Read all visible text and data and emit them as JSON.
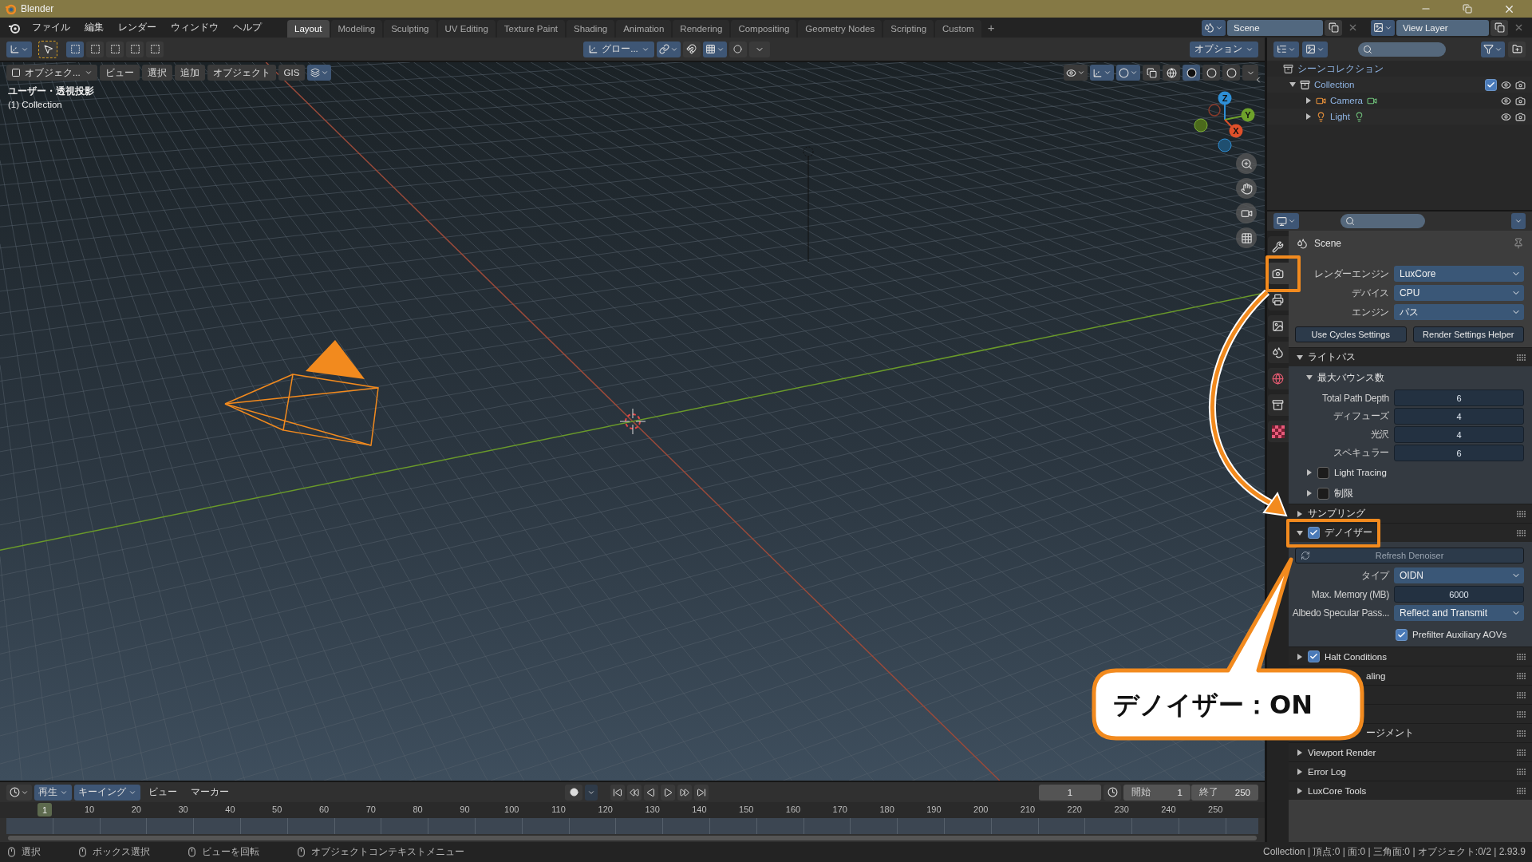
{
  "window": {
    "title": "Blender"
  },
  "menus": [
    "ファイル",
    "編集",
    "レンダー",
    "ウィンドウ",
    "ヘルプ"
  ],
  "workspaces": [
    {
      "label": "Layout",
      "selected": true
    },
    {
      "label": "Modeling",
      "selected": false
    },
    {
      "label": "Sculpting",
      "selected": false
    },
    {
      "label": "UV Editing",
      "selected": false
    },
    {
      "label": "Texture Paint",
      "selected": false
    },
    {
      "label": "Shading",
      "selected": false
    },
    {
      "label": "Animation",
      "selected": false
    },
    {
      "label": "Rendering",
      "selected": false
    },
    {
      "label": "Compositing",
      "selected": false
    },
    {
      "label": "Geometry Nodes",
      "selected": false
    },
    {
      "label": "Scripting",
      "selected": false
    },
    {
      "label": "Custom",
      "selected": false
    }
  ],
  "add_workspace": "+",
  "scene": "Scene",
  "view_layer": "View Layer",
  "tool_header": {
    "orientation": "グロー...",
    "options": "オプション"
  },
  "viewport": {
    "mode": "オブジェク...",
    "menus": [
      "ビュー",
      "選択",
      "追加",
      "オブジェクト",
      "GIS"
    ],
    "view_name": "ユーザー・透視投影",
    "collection": "(1) Collection",
    "axes": [
      "Z",
      "Y",
      "X"
    ]
  },
  "outliner": {
    "title": "シーンコレクション",
    "items": [
      {
        "label": "Collection",
        "checked": true,
        "expanded": true,
        "children": [
          {
            "label": "Camera",
            "kind": "camera"
          },
          {
            "label": "Light",
            "kind": "light"
          }
        ]
      }
    ]
  },
  "properties": {
    "context": "Scene",
    "tabs": [
      {
        "kind": "tool",
        "selected": false
      },
      {
        "kind": "render",
        "selected": true
      },
      {
        "kind": "output",
        "selected": false
      },
      {
        "kind": "view_layer",
        "selected": false
      },
      {
        "kind": "scene",
        "selected": false
      },
      {
        "kind": "world",
        "selected": false
      },
      {
        "kind": "collection",
        "selected": false
      },
      {
        "kind": "texture",
        "selected": false
      }
    ],
    "rows": [
      {
        "kind": "dropdown",
        "label": "レンダーエンジン",
        "value": "LuxCore"
      },
      {
        "kind": "dropdown",
        "label": "デバイス",
        "value": "CPU"
      },
      {
        "kind": "dropdown",
        "label": "エンジン",
        "value": "パス"
      },
      {
        "kind": "buttons",
        "items": [
          "Use Cycles Settings",
          "Render Settings Helper"
        ]
      },
      {
        "kind": "panel",
        "label": "ライトパス",
        "expanded": true
      },
      {
        "kind": "subpanel",
        "label": "最大バウンス数",
        "expanded": true
      },
      {
        "kind": "number",
        "label": "Total Path Depth",
        "value": "6"
      },
      {
        "kind": "number",
        "label": "ディフューズ",
        "value": "4"
      },
      {
        "kind": "number",
        "label": "光沢",
        "value": "4"
      },
      {
        "kind": "number",
        "label": "スペキュラー",
        "value": "6"
      },
      {
        "kind": "subpanel_check",
        "label": "Light Tracing",
        "checked": false,
        "expanded": false
      },
      {
        "kind": "subpanel_check",
        "label": "制限",
        "checked": false,
        "expanded": false
      },
      {
        "kind": "panel",
        "label": "サンプリング",
        "expanded": false
      },
      {
        "kind": "panel_check",
        "label": "デノイザー",
        "checked": true,
        "expanded": true
      },
      {
        "kind": "action",
        "label": "Refresh Denoiser",
        "disabled": true
      },
      {
        "kind": "dropdown",
        "label": "タイプ",
        "value": "OIDN"
      },
      {
        "kind": "number",
        "label": "Max. Memory (MB)",
        "value": "6000"
      },
      {
        "kind": "dropdown",
        "label": "Albedo Specular Pass...",
        "value": "Reflect and Transmit"
      },
      {
        "kind": "check",
        "label": "Prefilter Auxiliary AOVs",
        "checked": true
      },
      {
        "kind": "panel_check",
        "label": "Halt Conditions",
        "checked": true,
        "expanded": false
      },
      {
        "kind": "panel_clipped",
        "label": "aling"
      },
      {
        "kind": "covered"
      },
      {
        "kind": "covered"
      },
      {
        "kind": "panel_clipped",
        "label": "ージメント"
      },
      {
        "kind": "panel",
        "label": "Viewport Render",
        "expanded": false
      },
      {
        "kind": "panel",
        "label": "Error Log",
        "expanded": false
      },
      {
        "kind": "panel",
        "label": "LuxCore Tools",
        "expanded": false
      }
    ]
  },
  "timeline": {
    "menus": [
      "再生",
      "キーイング",
      "ビュー",
      "マーカー"
    ],
    "current_frame": "1",
    "start_label": "開始",
    "start": "1",
    "end_label": "終了",
    "end": "250",
    "playhead": "1",
    "ticks": [
      "10",
      "20",
      "30",
      "40",
      "50",
      "60",
      "70",
      "80",
      "90",
      "100",
      "110",
      "120",
      "130",
      "140",
      "150",
      "160",
      "170",
      "180",
      "190",
      "200",
      "210",
      "220",
      "230",
      "240",
      "250"
    ]
  },
  "status_bar": {
    "hints": [
      "選択",
      "ボックス選択",
      "ビューを回転",
      "オブジェクトコンテキストメニュー"
    ],
    "stats": "Collection | 頂点:0 | 面:0 | 三角面:0 | オブジェクト:0/2 | 2.93.9"
  },
  "callout": {
    "text": "デノイザー：ON"
  }
}
